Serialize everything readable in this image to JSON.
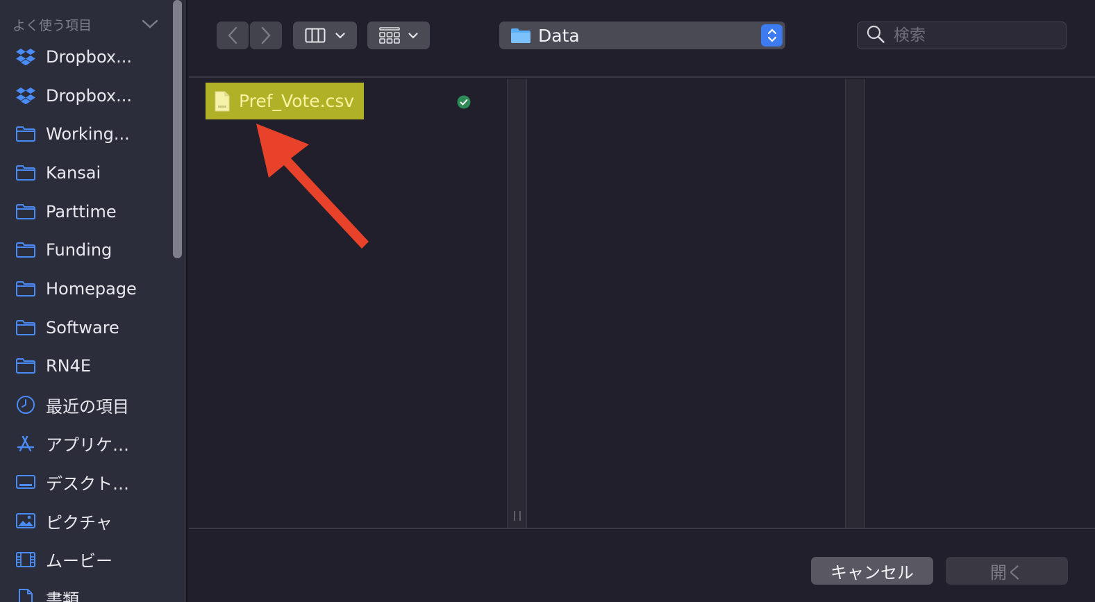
{
  "sidebar": {
    "header": "よく使う項目",
    "items": [
      {
        "label": "Dropbox...",
        "icon": "dropbox-icon"
      },
      {
        "label": "Dropbox...",
        "icon": "dropbox-icon"
      },
      {
        "label": "Working...",
        "icon": "folder-icon"
      },
      {
        "label": "Kansai",
        "icon": "folder-icon"
      },
      {
        "label": "Parttime",
        "icon": "folder-icon"
      },
      {
        "label": "Funding",
        "icon": "folder-icon"
      },
      {
        "label": "Homepage",
        "icon": "folder-icon"
      },
      {
        "label": "Software",
        "icon": "folder-icon"
      },
      {
        "label": "RN4E",
        "icon": "folder-icon"
      },
      {
        "label": "最近の項目",
        "icon": "clock-icon"
      },
      {
        "label": "アプリケ…",
        "icon": "applications-icon"
      },
      {
        "label": "デスクト…",
        "icon": "desktop-icon"
      },
      {
        "label": "ピクチャ",
        "icon": "pictures-icon"
      },
      {
        "label": "ムービー",
        "icon": "movies-icon"
      },
      {
        "label": "書類",
        "icon": "documents-icon"
      }
    ]
  },
  "toolbar": {
    "location": "Data",
    "search_placeholder": "検索"
  },
  "files": [
    {
      "name": "Pref_Vote.csv",
      "selected": true,
      "synced": true
    }
  ],
  "footer": {
    "cancel_label": "キャンセル",
    "open_label": "開く"
  },
  "colors": {
    "accent": "#3c7bf0",
    "sidebar_icon": "#4a8cf7",
    "selection": "#b1b128",
    "arrow": "#e8432a"
  }
}
